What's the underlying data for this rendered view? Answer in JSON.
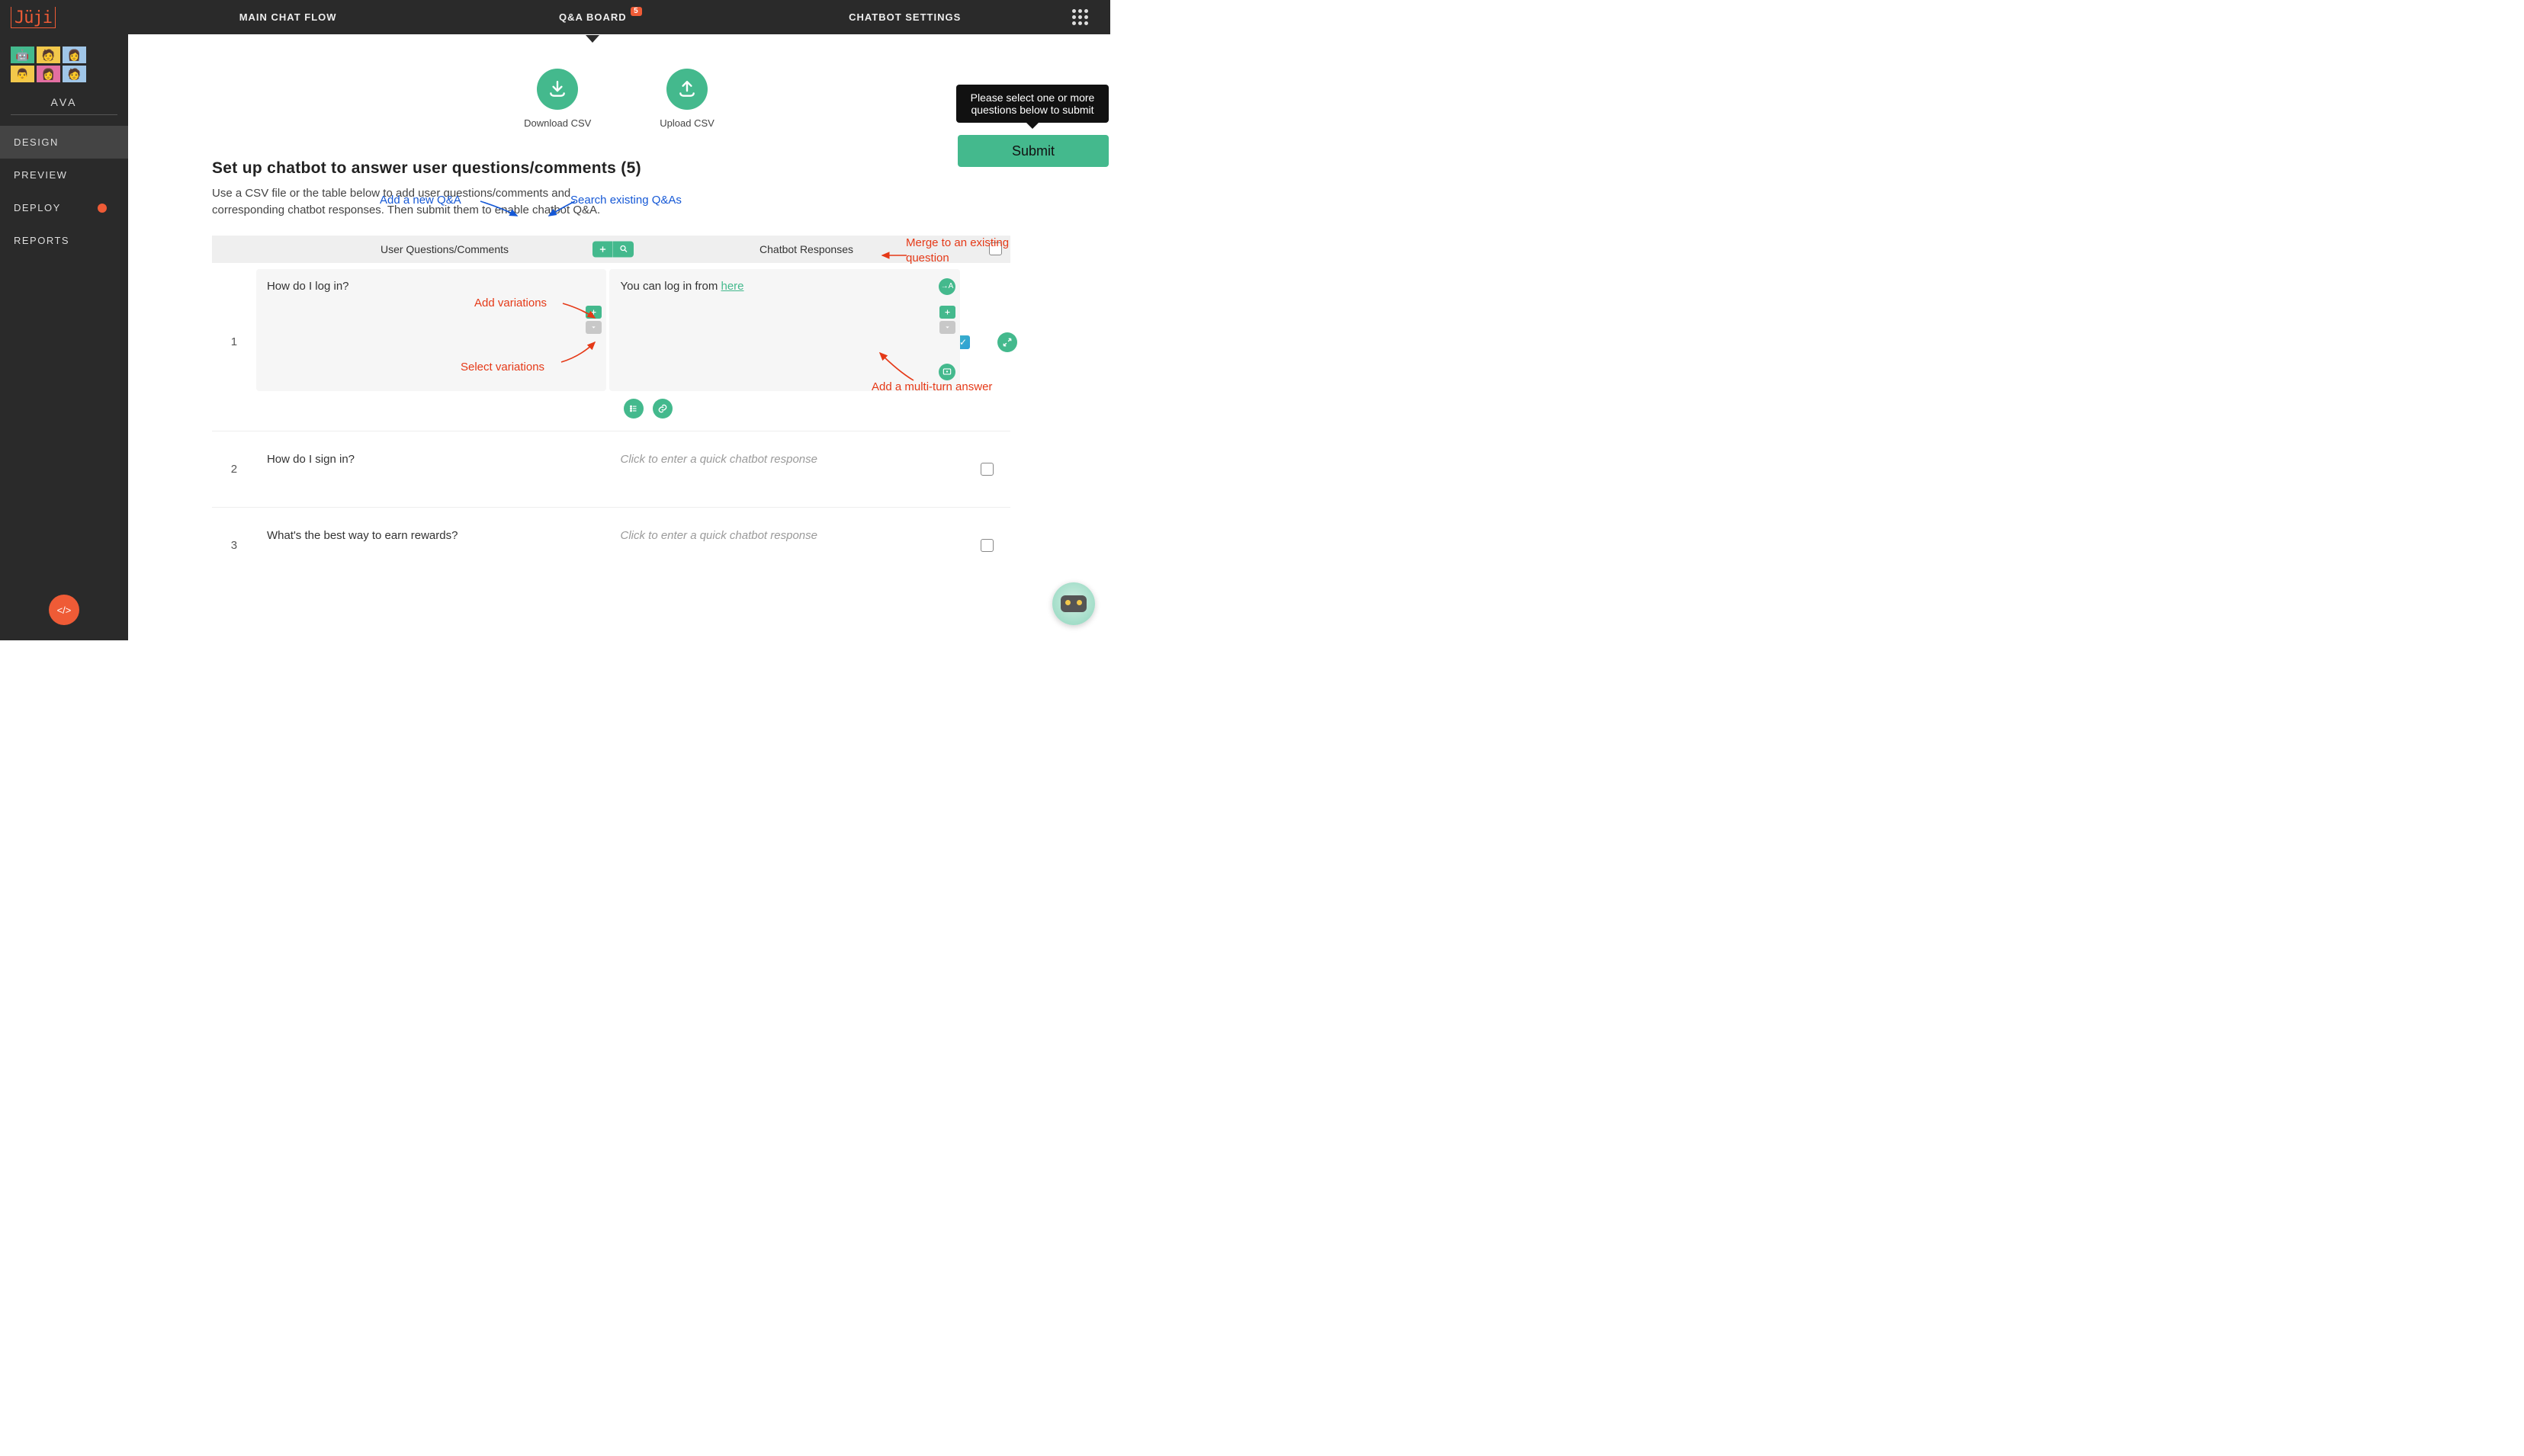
{
  "brand": "Jüji",
  "top_tabs": {
    "main_flow": "MAIN CHAT FLOW",
    "qaboard": "Q&A BOARD",
    "qaboard_badge": "5",
    "settings": "CHATBOT SETTINGS"
  },
  "sidebar": {
    "bot_name": "AVA",
    "items": [
      "DESIGN",
      "PREVIEW",
      "DEPLOY",
      "REPORTS"
    ]
  },
  "csv": {
    "download": "Download CSV",
    "upload": "Upload CSV"
  },
  "page": {
    "title": "Set up chatbot to answer user questions/comments (5)",
    "subtitle": "Use a CSV file or the table below to add user questions/comments and corresponding chatbot responses. Then submit them to enable chatbot Q&A."
  },
  "tooltip": "Please select one or more questions below to submit",
  "submit_label": "Submit",
  "table": {
    "header_q": "User Questions/Comments",
    "header_a": "Chatbot Responses",
    "rows": [
      {
        "num": "1",
        "question": "How do I log in?",
        "answer_prefix": "You can log in from ",
        "answer_link": "here",
        "placeholder": ""
      },
      {
        "num": "2",
        "question": "How do I sign in?",
        "answer_prefix": "",
        "answer_link": "",
        "placeholder": "Click to enter a quick chatbot response"
      },
      {
        "num": "3",
        "question": "What's the best way to earn rewards?",
        "answer_prefix": "",
        "answer_link": "",
        "placeholder": "Click to enter a quick chatbot response"
      }
    ]
  },
  "annotations": {
    "add_new_qa": "Add a new Q&A",
    "search_qas": "Search existing Q&As",
    "add_variations": "Add variations",
    "select_variations": "Select variations",
    "merge_existing": "Merge to an existing question",
    "add_multiturn": "Add a multi-turn answer"
  },
  "code_fab": "</>"
}
